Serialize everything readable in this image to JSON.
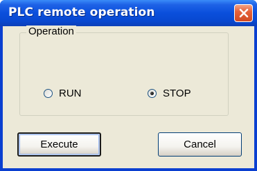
{
  "window": {
    "title": "PLC remote operation"
  },
  "operation_group": {
    "label": "Operation",
    "options": [
      {
        "label": "RUN",
        "selected": false
      },
      {
        "label": "STOP",
        "selected": true
      }
    ]
  },
  "buttons": {
    "execute_label": "Execute",
    "cancel_label": "Cancel"
  },
  "icons": {
    "close": "close-icon"
  },
  "colors": {
    "titlebar": "#0a4fdc",
    "client_background": "#ece9d8",
    "close_button": "#e5623a",
    "title_text": "#ffffff"
  }
}
